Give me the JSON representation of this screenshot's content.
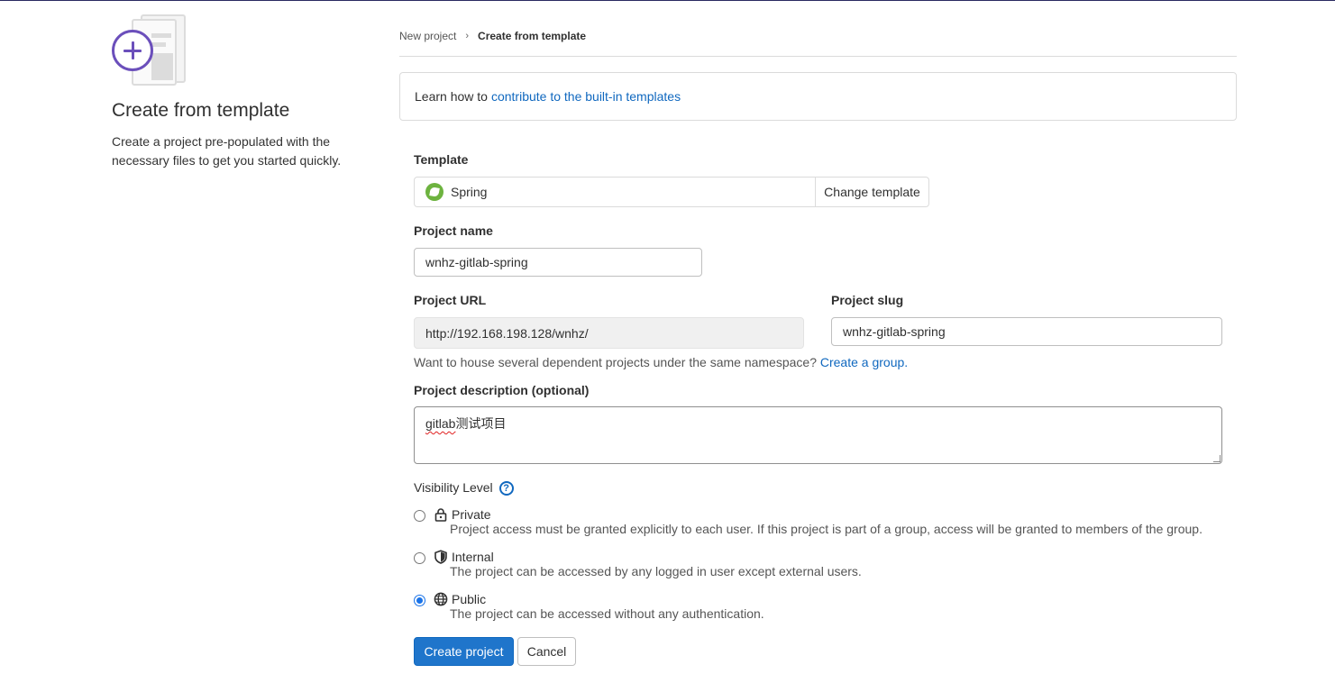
{
  "sidebar": {
    "title": "Create from template",
    "description": "Create a project pre-populated with the necessary files to get you started quickly."
  },
  "breadcrumb": {
    "parent": "New project",
    "current": "Create from template"
  },
  "info": {
    "prefix": "Learn how to",
    "link": "contribute to the built-in templates"
  },
  "form": {
    "template_label": "Template",
    "template_value": "Spring",
    "change_template": "Change template",
    "project_name_label": "Project name",
    "project_name": "wnhz-gitlab-spring",
    "project_url_label": "Project URL",
    "project_url": "http://192.168.198.128/wnhz/",
    "project_slug_label": "Project slug",
    "project_slug": "wnhz-gitlab-spring",
    "namespace_help": "Want to house several dependent projects under the same namespace?",
    "namespace_link": "Create a group.",
    "description_label": "Project description (optional)",
    "description_spell": "gitlab",
    "description_rest": "测试项目",
    "visibility_label": "Visibility Level",
    "visibility_help": "?",
    "visibility": [
      {
        "name": "Private",
        "icon": "lock-icon",
        "desc": "Project access must be granted explicitly to each user. If this project is part of a group, access will be granted to members of the group.",
        "selected": false
      },
      {
        "name": "Internal",
        "icon": "shield-icon",
        "desc": "The project can be accessed by any logged in user except external users.",
        "selected": false
      },
      {
        "name": "Public",
        "icon": "globe-icon",
        "desc": "The project can be accessed without any authentication.",
        "selected": true
      }
    ],
    "create_button": "Create project",
    "cancel_button": "Cancel"
  },
  "colors": {
    "accent": "#1f75cb",
    "link": "#1068bf",
    "brand_purple": "#6b4fbb",
    "spring_green": "#6db33f"
  }
}
